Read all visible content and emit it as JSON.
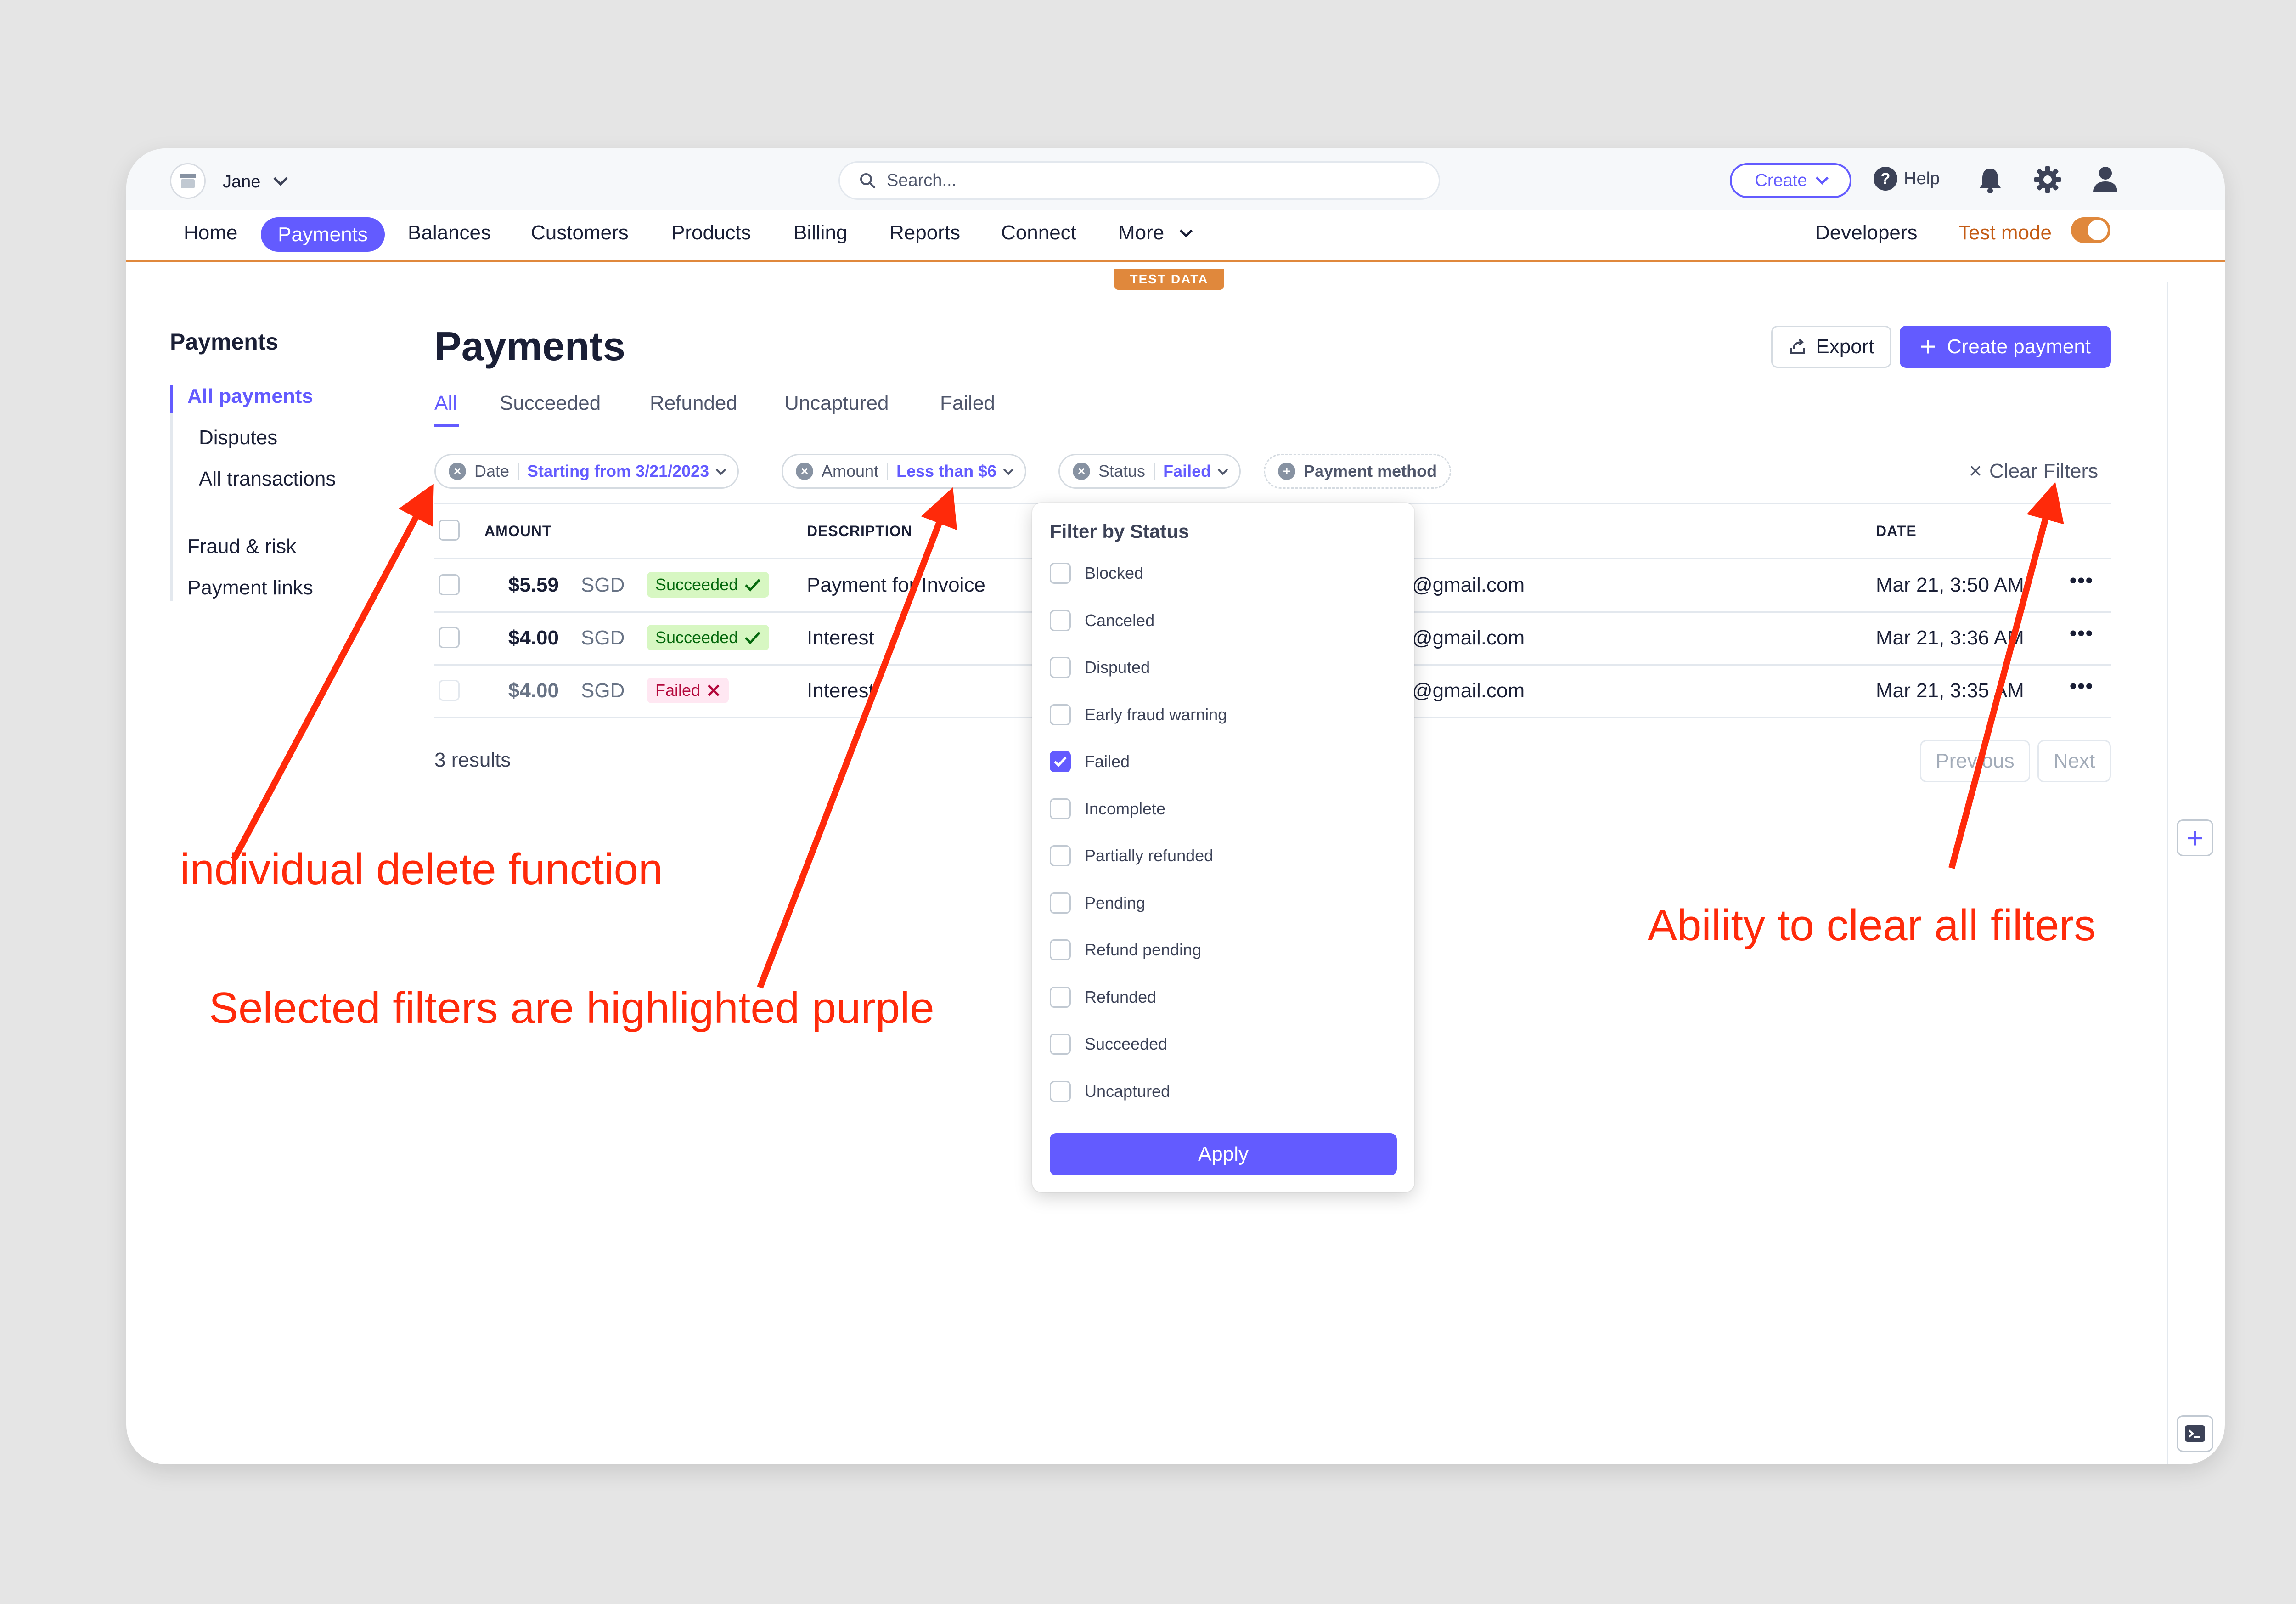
{
  "topbar": {
    "account_name": "Jane",
    "search_placeholder": "Search...",
    "create_label": "Create",
    "help_label": "Help"
  },
  "nav": {
    "items": [
      "Home",
      "Payments",
      "Balances",
      "Customers",
      "Products",
      "Billing",
      "Reports",
      "Connect",
      "More"
    ],
    "active": "Payments",
    "developers": "Developers",
    "test_mode": "Test mode",
    "test_mode_on": true,
    "test_data_banner": "TEST DATA"
  },
  "sidebar": {
    "title": "Payments",
    "items": [
      "All payments",
      "Disputes",
      "All transactions",
      "Fraud & risk",
      "Payment links"
    ],
    "active": "All payments"
  },
  "main": {
    "title": "Payments",
    "export_label": "Export",
    "create_payment_label": "Create payment",
    "tabs": [
      "All",
      "Succeeded",
      "Refunded",
      "Uncaptured",
      "Failed"
    ],
    "active_tab": "All",
    "filters": [
      {
        "name": "Date",
        "value": "Starting from 3/21/2023"
      },
      {
        "name": "Amount",
        "value": "Less than $6"
      },
      {
        "name": "Status",
        "value": "Failed"
      },
      {
        "name": "Payment method",
        "value": ""
      }
    ],
    "clear_filters": "Clear Filters",
    "columns": [
      "AMOUNT",
      "DESCRIPTION",
      "DATE"
    ],
    "rows": [
      {
        "amount": "$5.59",
        "currency": "SGD",
        "status": "Succeeded",
        "status_icon": "check-icon",
        "description": "Payment for Invoice",
        "email": "@gmail.com",
        "date": "Mar 21, 3:50 AM"
      },
      {
        "amount": "$4.00",
        "currency": "SGD",
        "status": "Succeeded",
        "status_icon": "check-icon",
        "description": "Interest",
        "email": "@gmail.com",
        "date": "Mar 21, 3:36 AM"
      },
      {
        "amount": "$4.00",
        "currency": "SGD",
        "status": "Failed",
        "status_icon": "x-icon",
        "description": "Interest",
        "email": "@gmail.com",
        "date": "Mar 21, 3:35 AM"
      }
    ],
    "results": "3 results",
    "previous": "Previous",
    "next": "Next"
  },
  "status_filter": {
    "title": "Filter by Status",
    "options": [
      {
        "label": "Blocked",
        "checked": false
      },
      {
        "label": "Canceled",
        "checked": false
      },
      {
        "label": "Disputed",
        "checked": false
      },
      {
        "label": "Early fraud warning",
        "checked": false
      },
      {
        "label": "Failed",
        "checked": true
      },
      {
        "label": "Incomplete",
        "checked": false
      },
      {
        "label": "Partially refunded",
        "checked": false
      },
      {
        "label": "Pending",
        "checked": false
      },
      {
        "label": "Refund pending",
        "checked": false
      },
      {
        "label": "Refunded",
        "checked": false
      },
      {
        "label": "Succeeded",
        "checked": false
      },
      {
        "label": "Uncaptured",
        "checked": false
      }
    ],
    "apply_label": "Apply"
  },
  "annotations": {
    "delete": "individual delete function",
    "highlight": "Selected filters are highlighted purple",
    "clear": "Ability to clear all filters"
  },
  "colors": {
    "accent": "#635bff",
    "test_mode": "#e0883c",
    "success_bg": "#d7f7c2",
    "fail_bg": "#ffe7f2",
    "annotation": "#ff2a0a"
  }
}
